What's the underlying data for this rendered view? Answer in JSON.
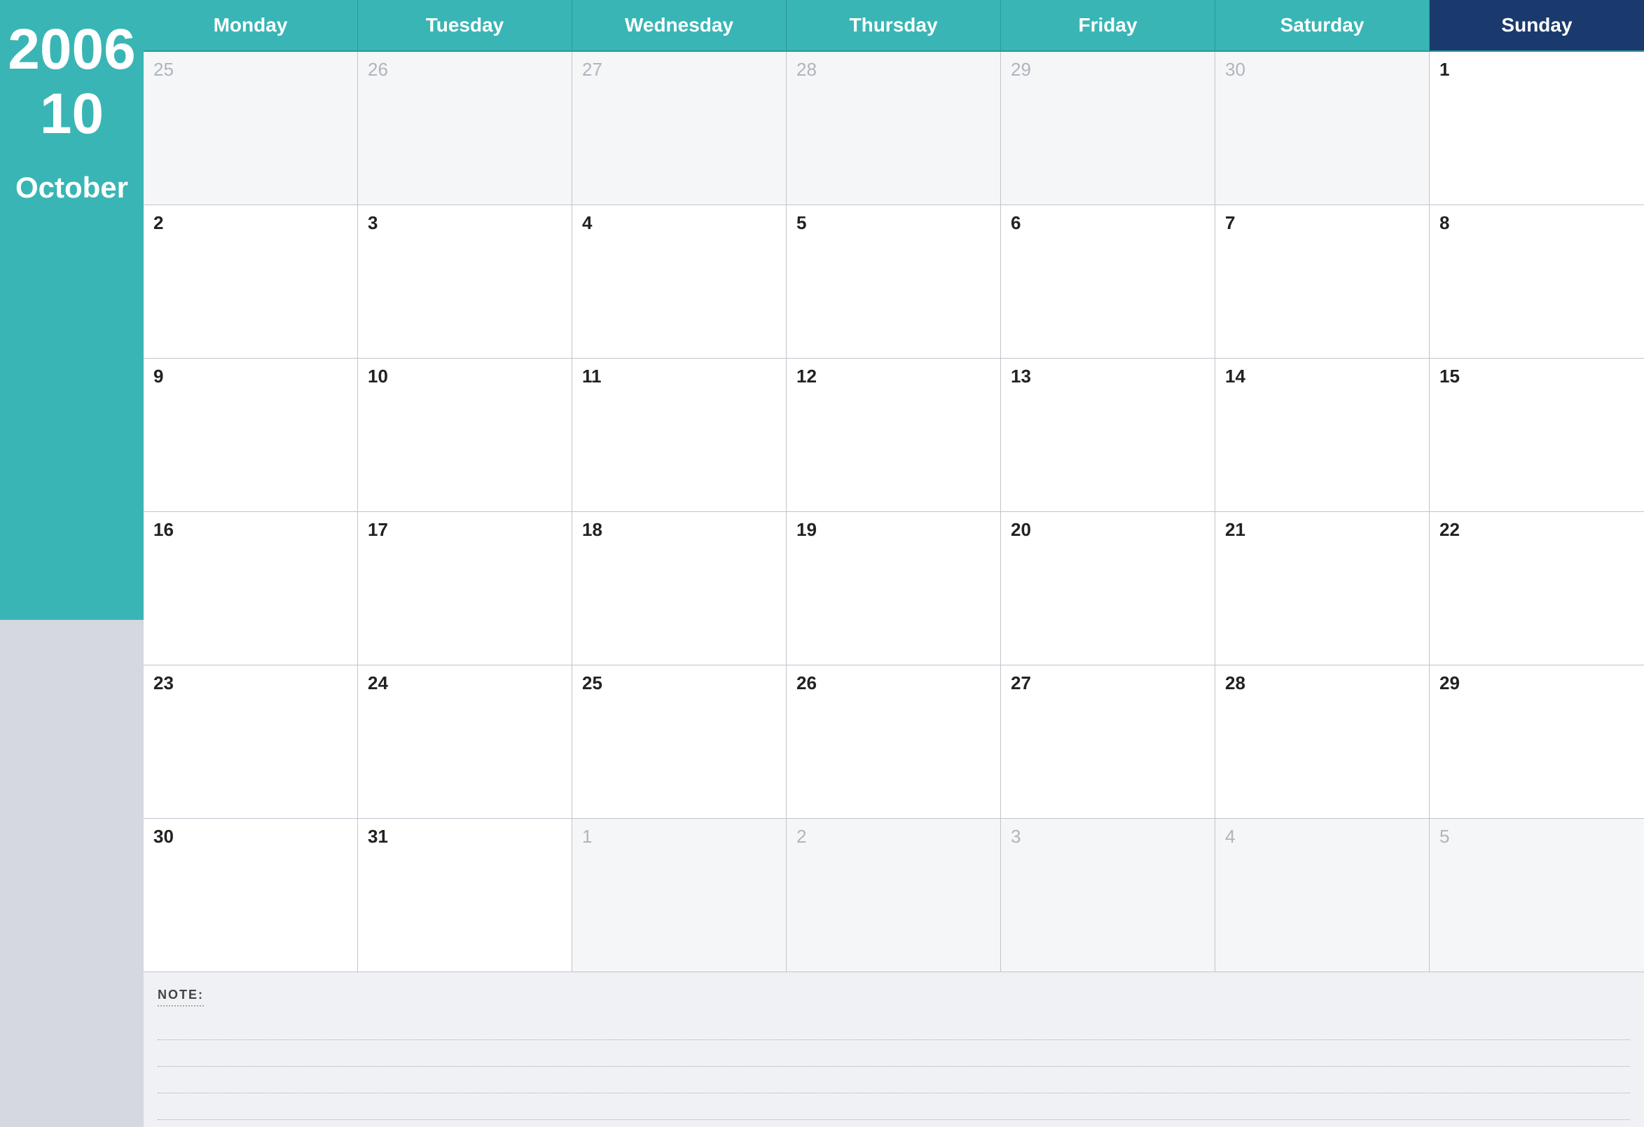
{
  "sidebar": {
    "year": "2006",
    "month_number": "10",
    "month_name": "October"
  },
  "header": {
    "days": [
      "Monday",
      "Tuesday",
      "Wednesday",
      "Thursday",
      "Friday",
      "Saturday",
      "Sunday"
    ]
  },
  "weeks": [
    [
      {
        "date": "25",
        "current": false
      },
      {
        "date": "26",
        "current": false
      },
      {
        "date": "27",
        "current": false
      },
      {
        "date": "28",
        "current": false
      },
      {
        "date": "29",
        "current": false
      },
      {
        "date": "30",
        "current": false
      },
      {
        "date": "1",
        "current": true
      }
    ],
    [
      {
        "date": "2",
        "current": true
      },
      {
        "date": "3",
        "current": true
      },
      {
        "date": "4",
        "current": true
      },
      {
        "date": "5",
        "current": true
      },
      {
        "date": "6",
        "current": true
      },
      {
        "date": "7",
        "current": true
      },
      {
        "date": "8",
        "current": true
      }
    ],
    [
      {
        "date": "9",
        "current": true
      },
      {
        "date": "10",
        "current": true
      },
      {
        "date": "11",
        "current": true
      },
      {
        "date": "12",
        "current": true
      },
      {
        "date": "13",
        "current": true
      },
      {
        "date": "14",
        "current": true
      },
      {
        "date": "15",
        "current": true
      }
    ],
    [
      {
        "date": "16",
        "current": true
      },
      {
        "date": "17",
        "current": true
      },
      {
        "date": "18",
        "current": true
      },
      {
        "date": "19",
        "current": true
      },
      {
        "date": "20",
        "current": true
      },
      {
        "date": "21",
        "current": true
      },
      {
        "date": "22",
        "current": true
      }
    ],
    [
      {
        "date": "23",
        "current": true
      },
      {
        "date": "24",
        "current": true
      },
      {
        "date": "25",
        "current": true
      },
      {
        "date": "26",
        "current": true
      },
      {
        "date": "27",
        "current": true
      },
      {
        "date": "28",
        "current": true
      },
      {
        "date": "29",
        "current": true
      }
    ],
    [
      {
        "date": "30",
        "current": true
      },
      {
        "date": "31",
        "current": true
      },
      {
        "date": "1",
        "current": false
      },
      {
        "date": "2",
        "current": false
      },
      {
        "date": "3",
        "current": false
      },
      {
        "date": "4",
        "current": false
      },
      {
        "date": "5",
        "current": false
      }
    ]
  ],
  "notes": {
    "label": "NOTE:",
    "lines": 4
  }
}
